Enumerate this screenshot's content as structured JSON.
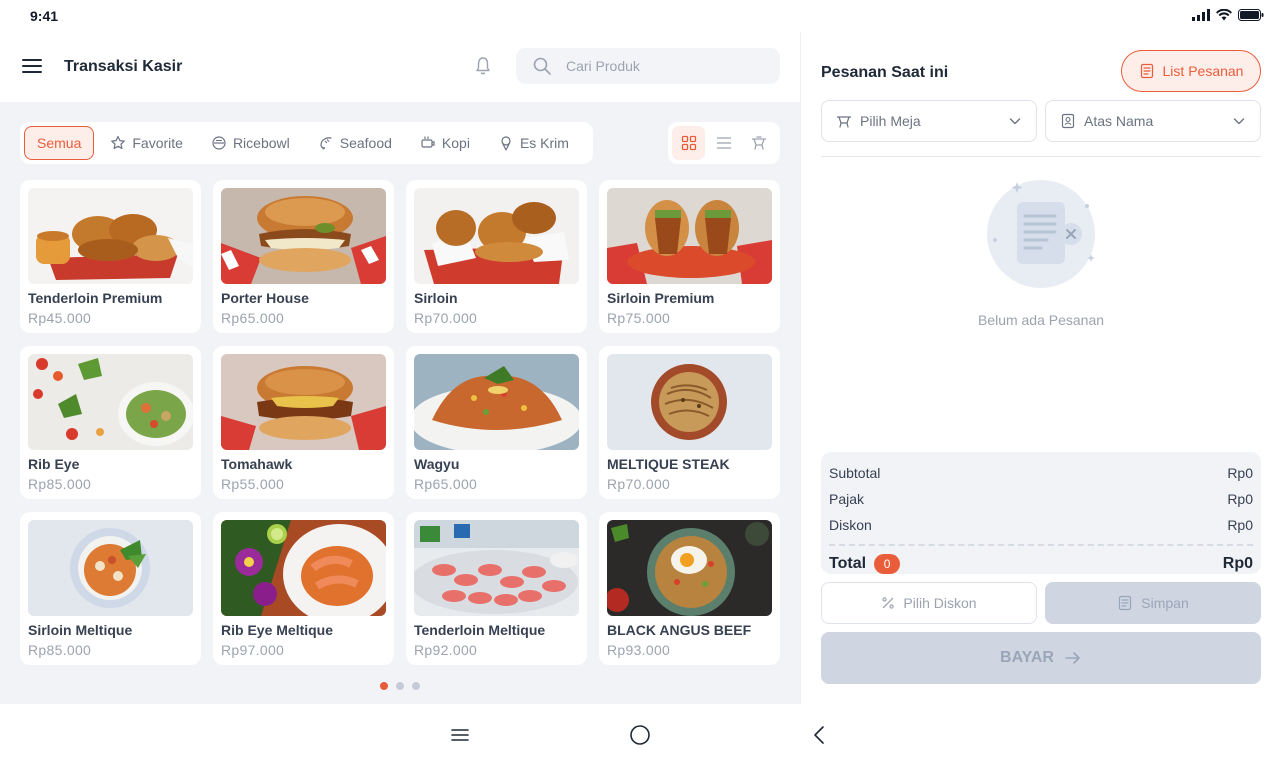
{
  "status_bar": {
    "time": "9:41"
  },
  "header": {
    "title": "Transaksi Kasir",
    "search_placeholder": "Cari Produk"
  },
  "categories": [
    {
      "label": "Semua",
      "icon": "none",
      "active": true
    },
    {
      "label": "Favorite",
      "icon": "star-icon"
    },
    {
      "label": "Ricebowl",
      "icon": "bowl-icon"
    },
    {
      "label": "Seafood",
      "icon": "shrimp-icon"
    },
    {
      "label": "Kopi",
      "icon": "coffee-icon"
    },
    {
      "label": "Es Krim",
      "icon": "ice-cream-icon"
    }
  ],
  "view_modes": [
    {
      "name": "grid-view-icon",
      "active": true
    },
    {
      "name": "list-view-icon",
      "active": false
    },
    {
      "name": "table-view-icon",
      "active": false
    }
  ],
  "products": [
    {
      "name": "Tenderloin Premium",
      "price": "Rp45.000",
      "image": "fried-chicken"
    },
    {
      "name": "Porter House",
      "price": "Rp65.000",
      "image": "chicken-burger"
    },
    {
      "name": "Sirloin",
      "price": "Rp70.000",
      "image": "fried-chicken"
    },
    {
      "name": "Sirloin Premium",
      "price": "Rp75.000",
      "image": "chicken-sandwich"
    },
    {
      "name": "Rib Eye",
      "price": "Rp85.000",
      "image": "salad"
    },
    {
      "name": "Tomahawk",
      "price": "Rp55.000",
      "image": "chicken-burger"
    },
    {
      "name": "Wagyu",
      "price": "Rp65.000",
      "image": "fried-rice"
    },
    {
      "name": "MELTIQUE STEAK",
      "price": "Rp70.000",
      "image": "noodles"
    },
    {
      "name": "Sirloin Meltique",
      "price": "Rp85.000",
      "image": "curry"
    },
    {
      "name": "Rib Eye Meltique",
      "price": "Rp97.000",
      "image": "shrimp-rice"
    },
    {
      "name": "Tenderloin Meltique",
      "price": "Rp92.000",
      "image": "shrimp-platter"
    },
    {
      "name": "BLACK ANGUS BEEF",
      "price": "Rp93.000",
      "image": "egg-rice"
    }
  ],
  "pagination": {
    "pages": 3,
    "current": 1
  },
  "order": {
    "title": "Pesanan Saat ini",
    "list_button": "List Pesanan",
    "table_select": "Pilih Meja",
    "name_select": "Atas Nama",
    "empty_text": "Belum ada Pesanan",
    "summary": {
      "subtotal_label": "Subtotal",
      "subtotal_value": "Rp0",
      "tax_label": "Pajak",
      "tax_value": "Rp0",
      "discount_label": "Diskon",
      "discount_value": "Rp0",
      "total_label": "Total",
      "total_count": "0",
      "total_value": "Rp0"
    },
    "discount_button": "Pilih Diskon",
    "save_button": "Simpan",
    "pay_button": "BAYAR"
  },
  "colors": {
    "accent": "#ea5d3b",
    "accent_soft": "#fdeee9",
    "panel_bg": "#f1f3f7",
    "disabled": "#cfd6e2"
  }
}
